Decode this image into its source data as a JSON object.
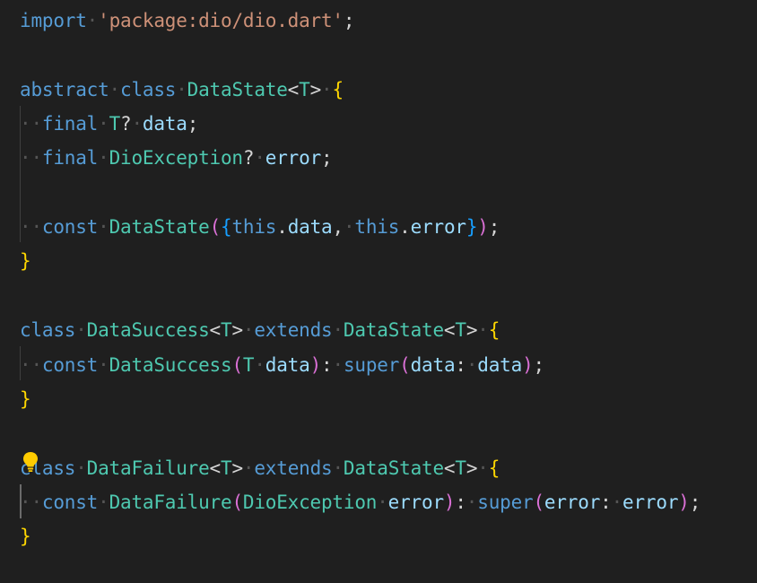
{
  "editor": {
    "language": "dart",
    "theme": {
      "background": "#1f1f1f",
      "keyword": "#569cd6",
      "type": "#4ec9b0",
      "string": "#ce9178",
      "variable": "#9cdcfe",
      "punctuation": "#d4d4d4",
      "bracket_level_1": "#ffd700",
      "bracket_level_2": "#da70d6",
      "bracket_level_3": "#179fff",
      "whitespace_dot": "#555555"
    },
    "lightbulb_icon": "lightbulb-icon",
    "lines": [
      {
        "tokens": [
          {
            "t": "import",
            "c": "kw"
          },
          {
            "t": "·",
            "c": "ws"
          },
          {
            "t": "'package:dio/dio.dart'",
            "c": "st"
          },
          {
            "t": ";",
            "c": "pu"
          }
        ]
      },
      {
        "tokens": []
      },
      {
        "tokens": [
          {
            "t": "abstract",
            "c": "kw"
          },
          {
            "t": "·",
            "c": "ws"
          },
          {
            "t": "class",
            "c": "kw"
          },
          {
            "t": "·",
            "c": "ws"
          },
          {
            "t": "DataState",
            "c": "ty"
          },
          {
            "t": "<",
            "c": "pu"
          },
          {
            "t": "T",
            "c": "ty"
          },
          {
            "t": ">",
            "c": "pu"
          },
          {
            "t": "·",
            "c": "ws"
          },
          {
            "t": "{",
            "c": "b1"
          }
        ]
      },
      {
        "tokens": [
          {
            "t": "··",
            "c": "ws"
          },
          {
            "t": "final",
            "c": "kw"
          },
          {
            "t": "·",
            "c": "ws"
          },
          {
            "t": "T",
            "c": "ty"
          },
          {
            "t": "?",
            "c": "pu"
          },
          {
            "t": "·",
            "c": "ws"
          },
          {
            "t": "data",
            "c": "va"
          },
          {
            "t": ";",
            "c": "pu"
          }
        ]
      },
      {
        "tokens": [
          {
            "t": "··",
            "c": "ws"
          },
          {
            "t": "final",
            "c": "kw"
          },
          {
            "t": "·",
            "c": "ws"
          },
          {
            "t": "DioException",
            "c": "ty"
          },
          {
            "t": "?",
            "c": "pu"
          },
          {
            "t": "·",
            "c": "ws"
          },
          {
            "t": "error",
            "c": "va"
          },
          {
            "t": ";",
            "c": "pu"
          }
        ]
      },
      {
        "tokens": []
      },
      {
        "tokens": [
          {
            "t": "··",
            "c": "ws"
          },
          {
            "t": "const",
            "c": "kw"
          },
          {
            "t": "·",
            "c": "ws"
          },
          {
            "t": "DataState",
            "c": "ty"
          },
          {
            "t": "(",
            "c": "b2"
          },
          {
            "t": "{",
            "c": "b3"
          },
          {
            "t": "this",
            "c": "kw"
          },
          {
            "t": ".",
            "c": "pu"
          },
          {
            "t": "data",
            "c": "va"
          },
          {
            "t": ",",
            "c": "pu"
          },
          {
            "t": "·",
            "c": "ws"
          },
          {
            "t": "this",
            "c": "kw"
          },
          {
            "t": ".",
            "c": "pu"
          },
          {
            "t": "error",
            "c": "va"
          },
          {
            "t": "}",
            "c": "b3"
          },
          {
            "t": ")",
            "c": "b2"
          },
          {
            "t": ";",
            "c": "pu"
          }
        ]
      },
      {
        "tokens": [
          {
            "t": "}",
            "c": "b1"
          }
        ]
      },
      {
        "tokens": []
      },
      {
        "tokens": [
          {
            "t": "class",
            "c": "kw"
          },
          {
            "t": "·",
            "c": "ws"
          },
          {
            "t": "DataSuccess",
            "c": "ty"
          },
          {
            "t": "<",
            "c": "pu"
          },
          {
            "t": "T",
            "c": "ty"
          },
          {
            "t": ">",
            "c": "pu"
          },
          {
            "t": "·",
            "c": "ws"
          },
          {
            "t": "extends",
            "c": "kw"
          },
          {
            "t": "·",
            "c": "ws"
          },
          {
            "t": "DataState",
            "c": "ty"
          },
          {
            "t": "<",
            "c": "pu"
          },
          {
            "t": "T",
            "c": "ty"
          },
          {
            "t": ">",
            "c": "pu"
          },
          {
            "t": "·",
            "c": "ws"
          },
          {
            "t": "{",
            "c": "b1"
          }
        ]
      },
      {
        "tokens": [
          {
            "t": "··",
            "c": "ws"
          },
          {
            "t": "const",
            "c": "kw"
          },
          {
            "t": "·",
            "c": "ws"
          },
          {
            "t": "DataSuccess",
            "c": "ty"
          },
          {
            "t": "(",
            "c": "b2"
          },
          {
            "t": "T",
            "c": "ty"
          },
          {
            "t": "·",
            "c": "ws"
          },
          {
            "t": "data",
            "c": "va"
          },
          {
            "t": ")",
            "c": "b2"
          },
          {
            "t": ":",
            "c": "pu"
          },
          {
            "t": "·",
            "c": "ws"
          },
          {
            "t": "super",
            "c": "kw"
          },
          {
            "t": "(",
            "c": "b2"
          },
          {
            "t": "data",
            "c": "va"
          },
          {
            "t": ":",
            "c": "pu"
          },
          {
            "t": "·",
            "c": "ws"
          },
          {
            "t": "data",
            "c": "va"
          },
          {
            "t": ")",
            "c": "b2"
          },
          {
            "t": ";",
            "c": "pu"
          }
        ]
      },
      {
        "tokens": [
          {
            "t": "}",
            "c": "b1"
          }
        ]
      },
      {
        "tokens": []
      },
      {
        "tokens": [
          {
            "t": "class",
            "c": "kw"
          },
          {
            "t": "·",
            "c": "ws"
          },
          {
            "t": "DataFailure",
            "c": "ty"
          },
          {
            "t": "<",
            "c": "pu"
          },
          {
            "t": "T",
            "c": "ty"
          },
          {
            "t": ">",
            "c": "pu"
          },
          {
            "t": "·",
            "c": "ws"
          },
          {
            "t": "extends",
            "c": "kw"
          },
          {
            "t": "·",
            "c": "ws"
          },
          {
            "t": "DataState",
            "c": "ty"
          },
          {
            "t": "<",
            "c": "pu"
          },
          {
            "t": "T",
            "c": "ty"
          },
          {
            "t": ">",
            "c": "pu"
          },
          {
            "t": "·",
            "c": "ws"
          },
          {
            "t": "{",
            "c": "b1"
          }
        ]
      },
      {
        "tokens": [
          {
            "t": "··",
            "c": "ws"
          },
          {
            "t": "const",
            "c": "kw"
          },
          {
            "t": "·",
            "c": "ws"
          },
          {
            "t": "DataFailure",
            "c": "ty"
          },
          {
            "t": "(",
            "c": "b2"
          },
          {
            "t": "DioException",
            "c": "ty"
          },
          {
            "t": "·",
            "c": "ws"
          },
          {
            "t": "error",
            "c": "va"
          },
          {
            "t": ")",
            "c": "b2"
          },
          {
            "t": ":",
            "c": "pu"
          },
          {
            "t": "·",
            "c": "ws"
          },
          {
            "t": "super",
            "c": "kw"
          },
          {
            "t": "(",
            "c": "b2"
          },
          {
            "t": "error",
            "c": "va"
          },
          {
            "t": ":",
            "c": "pu"
          },
          {
            "t": "·",
            "c": "ws"
          },
          {
            "t": "error",
            "c": "va"
          },
          {
            "t": ")",
            "c": "b2"
          },
          {
            "t": ";",
            "c": "pu"
          }
        ]
      },
      {
        "tokens": [
          {
            "t": "}",
            "c": "b1"
          }
        ]
      }
    ]
  }
}
